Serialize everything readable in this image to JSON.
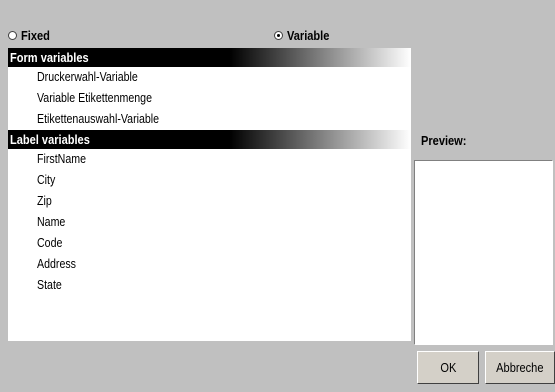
{
  "mode": {
    "fixed_label": "Fixed",
    "variable_label": "Variable",
    "selected": "Variable"
  },
  "form_variables": {
    "header": "Form variables",
    "items": [
      "Druckerwahl-Variable",
      "Variable Etikettenmenge",
      "Etikettenauswahl-Variable"
    ]
  },
  "label_variables": {
    "header": "Label variables",
    "items": [
      "FirstName",
      "City",
      "Zip",
      "Name",
      "Code",
      "Address",
      "State"
    ]
  },
  "preview": {
    "label": "Preview:"
  },
  "buttons": {
    "ok": "OK",
    "cancel": "Abbreche"
  }
}
